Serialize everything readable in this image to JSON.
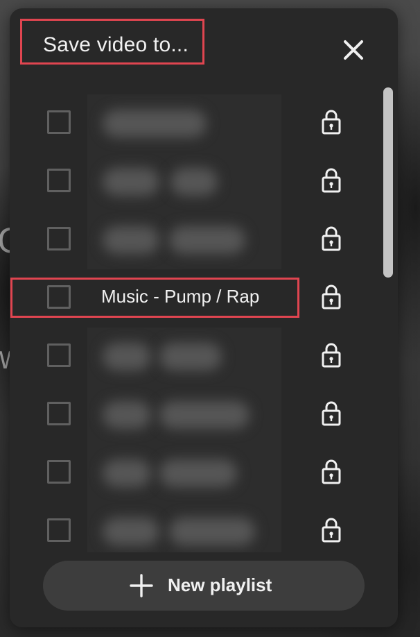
{
  "dialog": {
    "title": "Save video to...",
    "close_icon": "close-icon"
  },
  "playlists": [
    {
      "name": "",
      "blurred": true,
      "privacy_icon": "lock-icon",
      "checked": false
    },
    {
      "name": "",
      "blurred": true,
      "privacy_icon": "lock-icon",
      "checked": false
    },
    {
      "name": "",
      "blurred": true,
      "privacy_icon": "lock-icon",
      "checked": false
    },
    {
      "name": "Music - Pump / Rap",
      "blurred": false,
      "privacy_icon": "lock-icon",
      "checked": false,
      "highlighted": true
    },
    {
      "name": "",
      "blurred": true,
      "privacy_icon": "lock-icon",
      "checked": false
    },
    {
      "name": "",
      "blurred": true,
      "privacy_icon": "lock-icon",
      "checked": false
    },
    {
      "name": "",
      "blurred": true,
      "privacy_icon": "lock-icon",
      "checked": false
    },
    {
      "name": "",
      "blurred": true,
      "privacy_icon": "lock-icon",
      "checked": false
    }
  ],
  "new_playlist": {
    "label": "New playlist",
    "icon": "plus-icon"
  },
  "colors": {
    "dialog_bg": "#282828",
    "text": "#f1f1f1",
    "checkbox_border": "#606060",
    "button_bg": "#3d3d3d",
    "annotation_highlight": "#e04550"
  }
}
